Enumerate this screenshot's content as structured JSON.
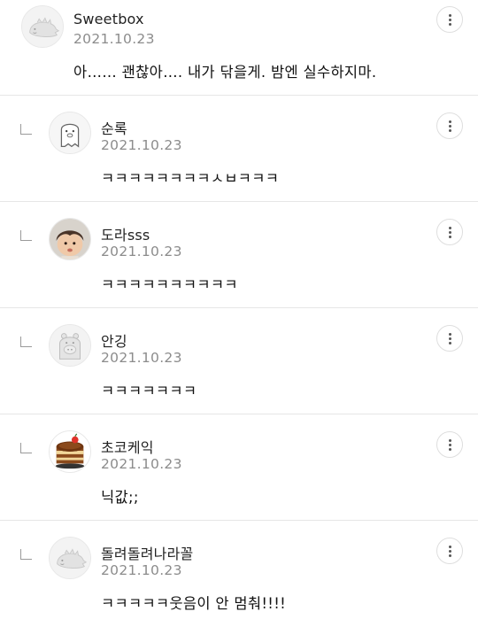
{
  "comments": [
    {
      "author": "Sweetbox",
      "date": "2021.10.23",
      "text": "아…… 괜찮아…. 내가 닦을게. 밤엔 실수하지마.",
      "avatar": "dinosaur-default-avatar"
    },
    {
      "author": "순록",
      "date": "2021.10.23",
      "text": "ㅋㅋㅋㅋㅋㅋㅋㅋㅅㅂㅋㅋㅋ",
      "avatar": "ghost-default-avatar"
    },
    {
      "author": "도라sss",
      "date": "2021.10.23",
      "text": "ㅋㅋㅋㅋㅋㅋㅋㅋㅋㅋ",
      "avatar": "baby-photo-avatar"
    },
    {
      "author": "안깅",
      "date": "2021.10.23",
      "text": "ㅋㅋㅋㅋㅋㅋㅋ",
      "avatar": "hippo-default-avatar"
    },
    {
      "author": "초코케익",
      "date": "2021.10.23",
      "text": "닉값;;",
      "avatar": "chocolate-cake-avatar"
    },
    {
      "author": "돌려돌려나라꼴",
      "date": "2021.10.23",
      "text": "ㅋㅋㅋㅋㅋ웃음이 안 멈춰!!!!",
      "avatar": "dinosaur-default-avatar"
    }
  ],
  "icons": {
    "more": "more-vertical-icon",
    "reply": "reply-arrow-icon"
  },
  "colors": {
    "author": "#222222",
    "date": "#8c8c8c",
    "divider": "#e6e6e6"
  }
}
